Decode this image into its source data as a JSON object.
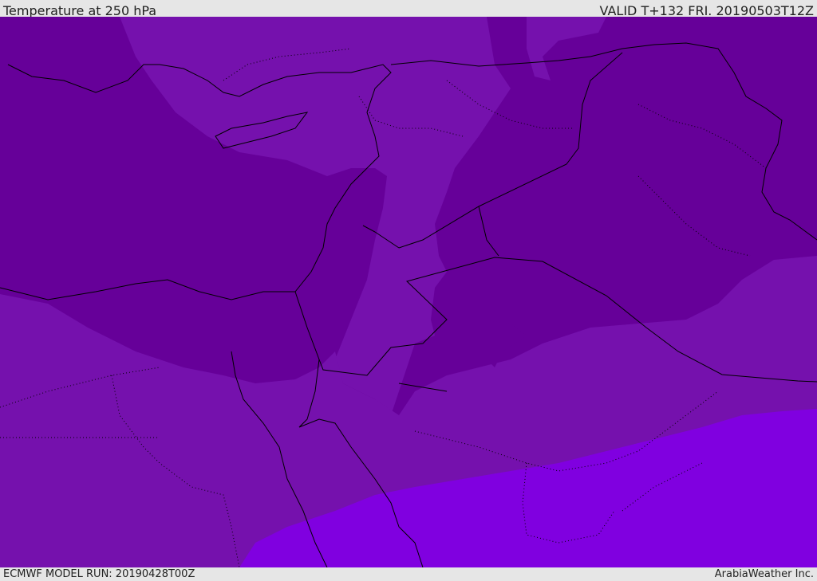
{
  "header": {
    "title": "Temperature at 250 hPa",
    "valid": "VALID T+132 FRI. 20190503T12Z"
  },
  "footer": {
    "model_run": "ECMWF MODEL RUN: 20190428T00Z",
    "credit": "ArabiaWeather Inc."
  },
  "map": {
    "field": "temperature",
    "level": "250 hPa",
    "colors": {
      "coldest": "#660099",
      "cold": "#7511ad",
      "cool": "#8000e0",
      "boundary": "#000000"
    }
  }
}
